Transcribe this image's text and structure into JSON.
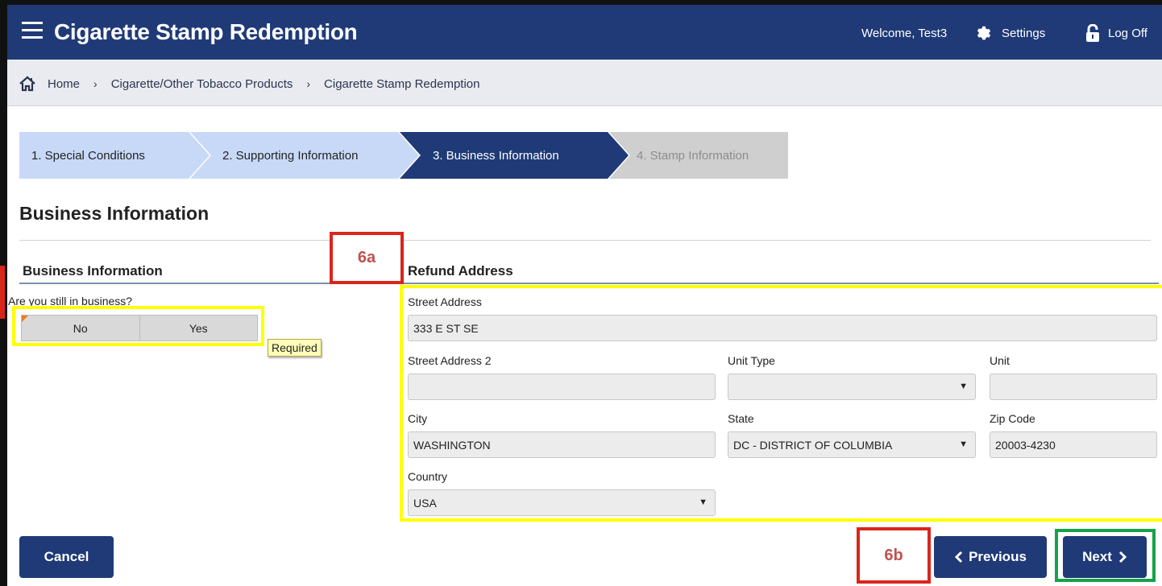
{
  "header": {
    "title": "Cigarette Stamp Redemption",
    "welcome": "Welcome, Test3",
    "settings_label": "Settings",
    "logoff_label": "Log Off"
  },
  "breadcrumb": {
    "items": [
      "Home",
      "Cigarette/Other Tobacco Products",
      "Cigarette Stamp Redemption"
    ],
    "separator": "›"
  },
  "steps": [
    {
      "label": "1. Special Conditions",
      "state": "complete"
    },
    {
      "label": "2. Supporting Information",
      "state": "complete"
    },
    {
      "label": "3. Business Information",
      "state": "active"
    },
    {
      "label": "4. Stamp Information",
      "state": "disabled"
    }
  ],
  "page": {
    "title": "Business Information"
  },
  "business_section": {
    "title": "Business Information",
    "question": "Are you still in business?",
    "options": [
      "No",
      "Yes"
    ],
    "required_badge": "Required"
  },
  "refund_address": {
    "title": "Refund Address",
    "street_address": {
      "label": "Street Address",
      "value": "333 E ST SE"
    },
    "street_address_2": {
      "label": "Street Address 2",
      "value": ""
    },
    "unit_type": {
      "label": "Unit Type",
      "value": ""
    },
    "unit": {
      "label": "Unit",
      "value": ""
    },
    "city": {
      "label": "City",
      "value": "WASHINGTON"
    },
    "state": {
      "label": "State",
      "value": "DC - DISTRICT OF COLUMBIA"
    },
    "zip": {
      "label": "Zip Code",
      "value": "20003-4230"
    },
    "country": {
      "label": "Country",
      "value": "USA"
    }
  },
  "buttons": {
    "cancel": "Cancel",
    "previous": "Previous",
    "next": "Next"
  },
  "annotations": {
    "label_6a": "6a",
    "label_6b": "6b"
  },
  "colors": {
    "primary": "#1f3a77",
    "step_complete": "#c8d9f7",
    "step_disabled": "#cfcfcf",
    "highlight_yellow": "#ffff00",
    "highlight_red": "#d9261c",
    "highlight_green": "#17a24a"
  }
}
